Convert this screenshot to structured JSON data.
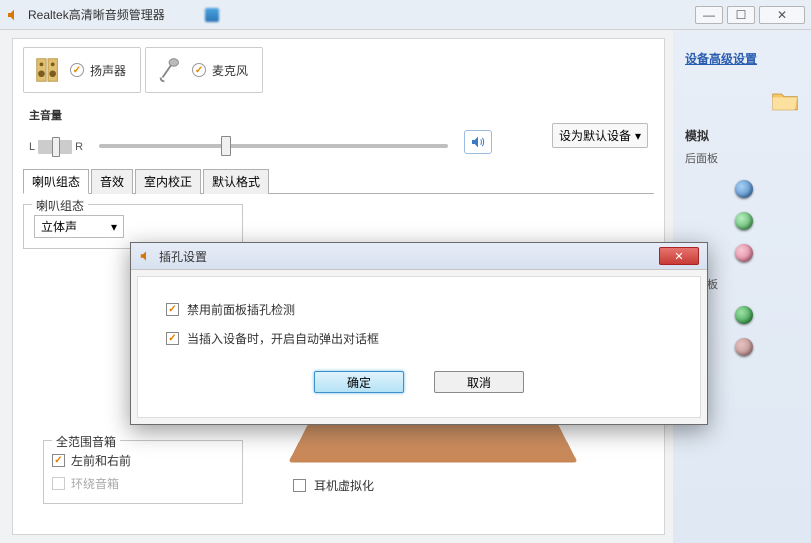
{
  "titlebar": {
    "title": "Realtek高清晰音频管理器"
  },
  "device_tabs": {
    "speaker": "扬声器",
    "mic": "麦克风"
  },
  "volume": {
    "label": "主音量",
    "left": "L",
    "right": "R"
  },
  "default_device": {
    "label": "设为默认设备"
  },
  "sub_tabs": {
    "config": "喇叭组态",
    "effects": "音效",
    "room": "室内校正",
    "format": "默认格式"
  },
  "speaker_config": {
    "legend": "喇叭组态",
    "dropdown": "立体声"
  },
  "fullrange": {
    "legend": "全范围音箱",
    "front": "左前和右前",
    "surround": "环绕音箱"
  },
  "headphone_virt": "耳机虚拟化",
  "side": {
    "advanced_link": "设备高级设置",
    "analog": "模拟",
    "rear_panel": "后面板",
    "front_panel": "前面板"
  },
  "dialog": {
    "title": "插孔设置",
    "opt1": "禁用前面板插孔检测",
    "opt2": "当插入设备时，开启自动弹出对话框",
    "ok": "确定",
    "cancel": "取消"
  }
}
